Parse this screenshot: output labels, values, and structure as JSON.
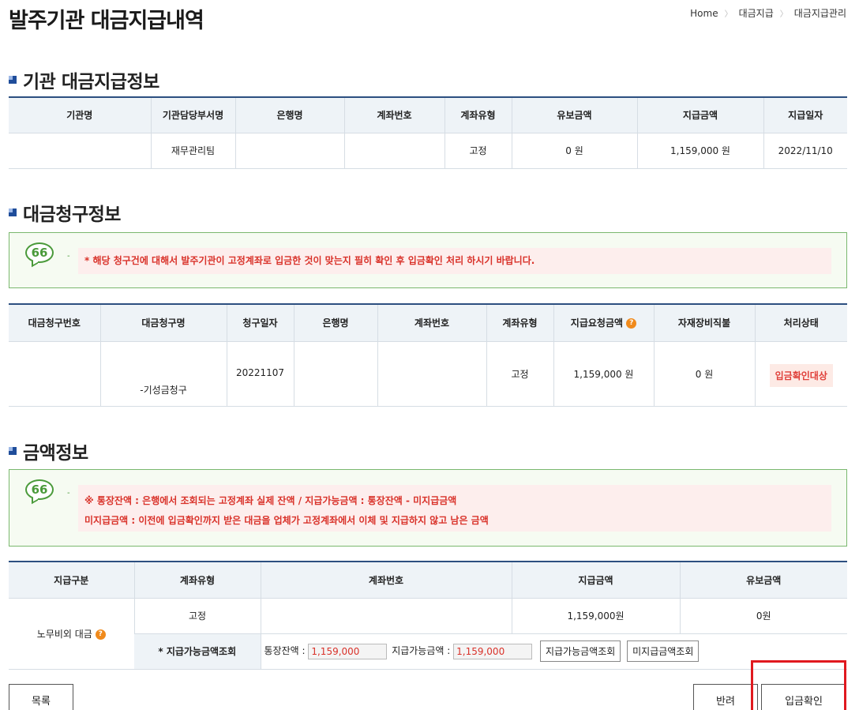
{
  "page": {
    "title": "발주기관 대금지급내역",
    "breadcrumb": [
      "Home",
      "대금지급",
      "대금지급관리"
    ]
  },
  "section1": {
    "title": "기관 대금지급정보",
    "headers": [
      "기관명",
      "기관담당부서명",
      "은행명",
      "계좌번호",
      "계좌유형",
      "유보금액",
      "지급금액",
      "지급일자"
    ],
    "row": [
      "",
      "재무관리팀",
      "",
      "",
      "고정",
      "0 원",
      "1,159,000 원",
      "2022/11/10"
    ]
  },
  "section2": {
    "title": "대금청구정보",
    "notice": "* 해당 청구건에 대해서 발주기관이 고정계좌로 입금한 것이 맞는지 필히 확인 후 입금확인 처리 하시기 바랍니다.",
    "headers": [
      "대금청구번호",
      "대금청구명",
      "청구일자",
      "은행명",
      "계좌번호",
      "계좌유형",
      "지급요청금액",
      "자재장비직불",
      "처리상태"
    ],
    "row": {
      "claim_no": "",
      "claim_name": "-기성금청구",
      "claim_date": "20221107",
      "bank": "",
      "account": "",
      "account_type": "고정",
      "request_amount": "1,159,000 원",
      "material_direct": "0 원",
      "status": "입금확인대상"
    }
  },
  "section3": {
    "title": "금액정보",
    "notice_line1": "※ 통장잔액 : 은행에서 조회되는 고정계좌 실제 잔액 / 지급가능금액 : 통장잔액 - 미지급금액",
    "notice_line2": "미지급금액 : 이전에 입금확인까지 받은 대금을 업체가 고정계좌에서 이체 및 지급하지 않고 남은 금액",
    "headers": [
      "지급구분",
      "계좌유형",
      "계좌번호",
      "지급금액",
      "유보금액"
    ],
    "row": {
      "category": "노무비외 대금",
      "account_type": "고정",
      "account": "",
      "pay_amount": "1,159,000원",
      "reserve_amount": "0원"
    },
    "inquiry": {
      "label": "* 지급가능금액조회",
      "balance_label": "통장잔액 :",
      "balance_value": "1,159,000",
      "available_label": "지급가능금액 :",
      "available_value": "1,159,000",
      "btn_available": "지급가능금액조회",
      "btn_unpaid": "미지급금액조회"
    }
  },
  "buttons": {
    "list": "목록",
    "reject": "반려",
    "confirm": "입금확인"
  },
  "colors": {
    "header_border": "#2c4f80",
    "notice_text": "#d9322a",
    "highlight": "#e0191f",
    "help_icon": "#f08a1c"
  },
  "icons": {
    "quote": "quote-bubble-icon",
    "help": "question-icon",
    "section_marker": "square-marker-icon"
  }
}
